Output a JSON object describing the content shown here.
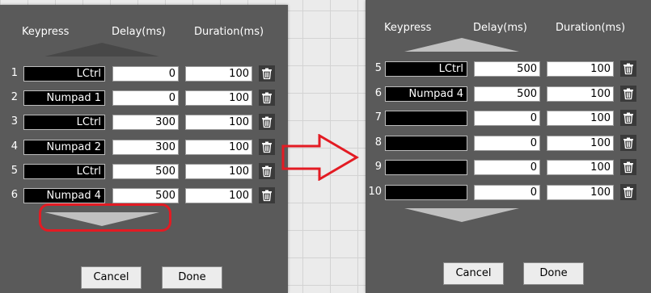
{
  "headers": {
    "keypress": "Keypress",
    "delay": "Delay(ms)",
    "duration": "Duration(ms)"
  },
  "buttons": {
    "cancel": "Cancel",
    "done": "Done"
  },
  "left_panel": {
    "rows": [
      {
        "num": "1",
        "key": "LCtrl",
        "delay": "0",
        "duration": "100"
      },
      {
        "num": "2",
        "key": "Numpad 1",
        "delay": "0",
        "duration": "100"
      },
      {
        "num": "3",
        "key": "LCtrl",
        "delay": "300",
        "duration": "100"
      },
      {
        "num": "4",
        "key": "Numpad 2",
        "delay": "300",
        "duration": "100"
      },
      {
        "num": "5",
        "key": "LCtrl",
        "delay": "500",
        "duration": "100"
      },
      {
        "num": "6",
        "key": "Numpad 4",
        "delay": "500",
        "duration": "100"
      }
    ]
  },
  "right_panel": {
    "rows": [
      {
        "num": "5",
        "key": "LCtrl",
        "delay": "500",
        "duration": "100"
      },
      {
        "num": "6",
        "key": "Numpad 4",
        "delay": "500",
        "duration": "100"
      },
      {
        "num": "7",
        "key": "",
        "delay": "0",
        "duration": "100"
      },
      {
        "num": "8",
        "key": "",
        "delay": "0",
        "duration": "100"
      },
      {
        "num": "9",
        "key": "",
        "delay": "0",
        "duration": "100"
      },
      {
        "num": "10",
        "key": "",
        "delay": "0",
        "duration": "100"
      }
    ]
  },
  "colors": {
    "panel": "#5a5a5a",
    "highlight": "#e31b23",
    "key_field": "#000000"
  },
  "icons": {
    "delete": "trash-icon",
    "scroll_up": "triangle-up-icon",
    "scroll_down": "triangle-down-icon",
    "annotation": "red-arrow-icon"
  }
}
